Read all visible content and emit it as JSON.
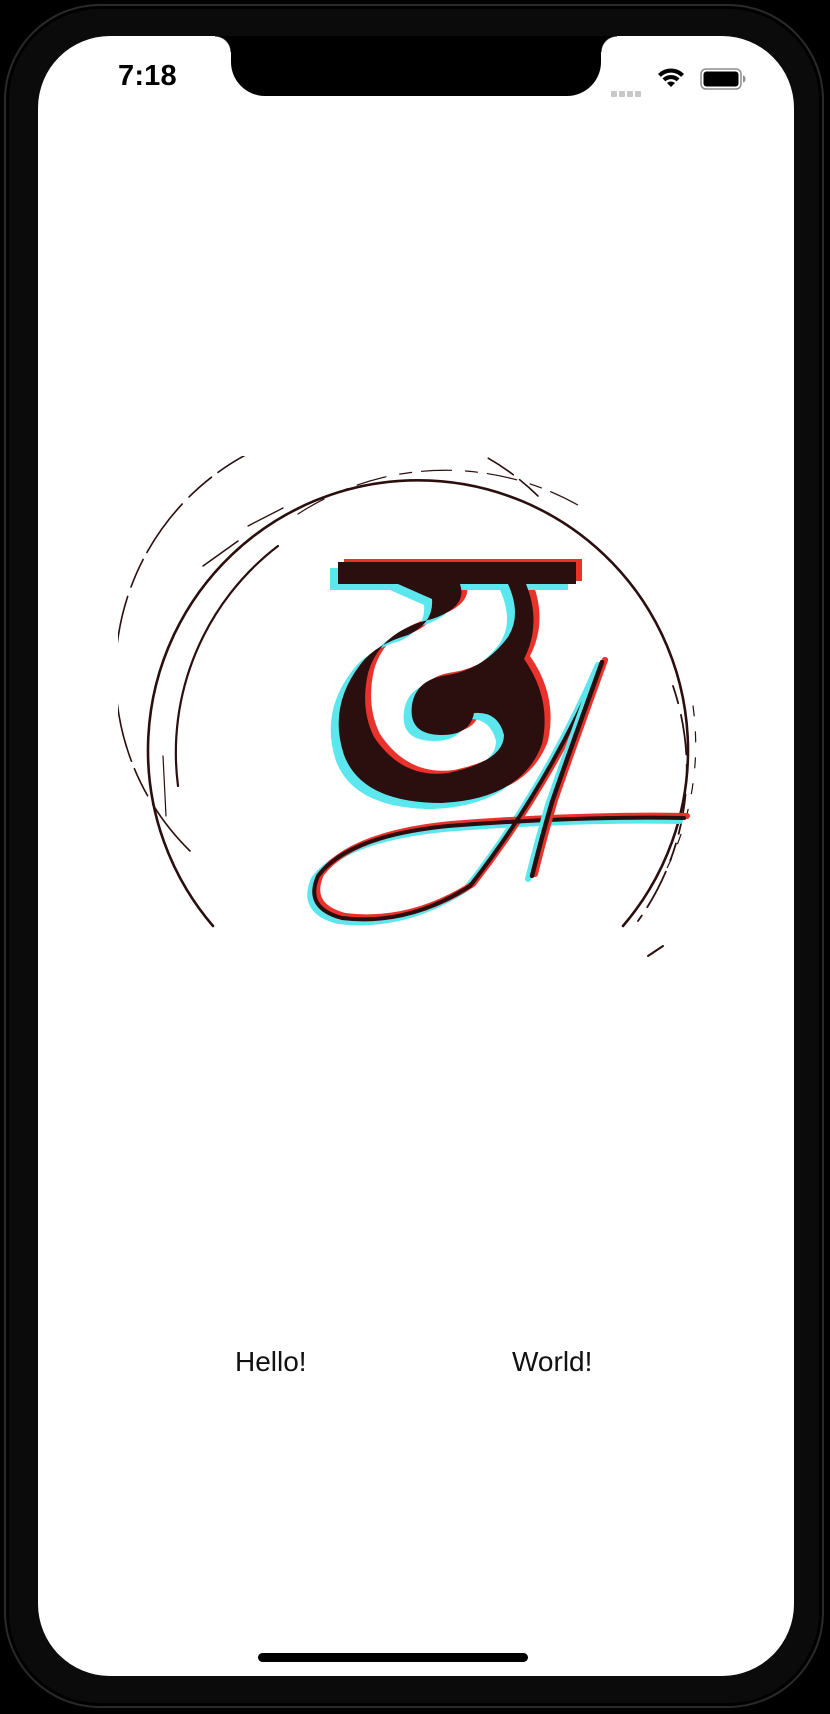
{
  "status_bar": {
    "time": "7:18",
    "icons": [
      "signal-icon",
      "wifi-icon",
      "battery-icon"
    ]
  },
  "logo": {
    "icon": "devanagari-monogram-logo",
    "colors": {
      "ink": "#2b0e0e",
      "red_offset": "#e8322b",
      "cyan_offset": "#5ce7ef"
    }
  },
  "labels": {
    "hello": "Hello!",
    "world": "World!"
  },
  "theme": {
    "frame": "#000000",
    "screen": "#ffffff",
    "text": "#111111"
  }
}
